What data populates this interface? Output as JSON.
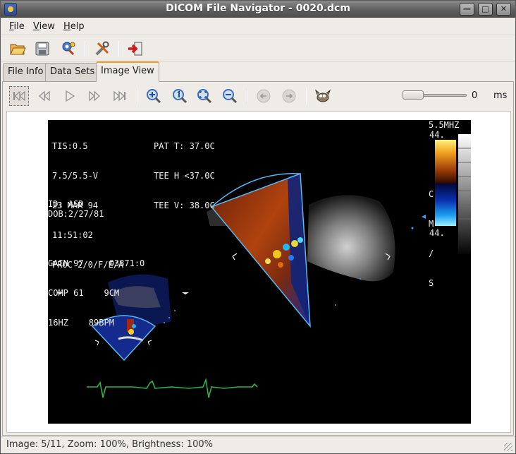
{
  "window": {
    "title": "DICOM File Navigator - 0020.dcm"
  },
  "menu": {
    "file": "File",
    "view": "View",
    "help": "Help"
  },
  "toolbar": {
    "icons": [
      "open-folder-icon",
      "save-icon",
      "anonymize-icon",
      "settings-tools-icon",
      "exit-icon"
    ]
  },
  "tabs": [
    {
      "label": "File Info"
    },
    {
      "label": "Data Sets"
    },
    {
      "label": "Image View",
      "active": true
    }
  ],
  "image_toolbar": {
    "icons": [
      "first-frame-icon",
      "previous-frame-icon",
      "play-icon",
      "next-frame-icon",
      "last-frame-icon",
      "zoom-in-icon",
      "zoom-actual-icon",
      "zoom-fit-icon",
      "zoom-out-icon",
      "rotate-left-icon",
      "rotate-right-icon",
      "gimp-icon"
    ],
    "frame_delay_value": "0",
    "frame_delay_unit": "ms",
    "frame_delay_level": 0
  },
  "overlay": {
    "top_left": [
      "TIS:0.5",
      "7.5/5.5-V",
      "23 MAR 94",
      "11:51:02",
      "PROC 2/0/F/E/A"
    ],
    "top_mid": [
      "PAT T: 37.0C",
      "TEE H <37.0C",
      "TEE V: 38.0C"
    ],
    "id": "ID: ASD",
    "dob": "DOB:2/27/81",
    "params": [
      "GAIN 97     03871:0",
      "COMP 61    9CM",
      "16HZ    89BPM"
    ],
    "freq": "5.5MHZ",
    "scale_top": "44.",
    "scale_bottom": "44.",
    "scale_unit": [
      "C",
      "M",
      "/",
      "S"
    ]
  },
  "status": {
    "text": "Image: 5/11, Zoom: 100%, Brightness: 100%"
  },
  "colors": {
    "accent_tab": "#f0a030",
    "ecg": "#2fb24a",
    "sector_outline": "#58b8f0"
  }
}
